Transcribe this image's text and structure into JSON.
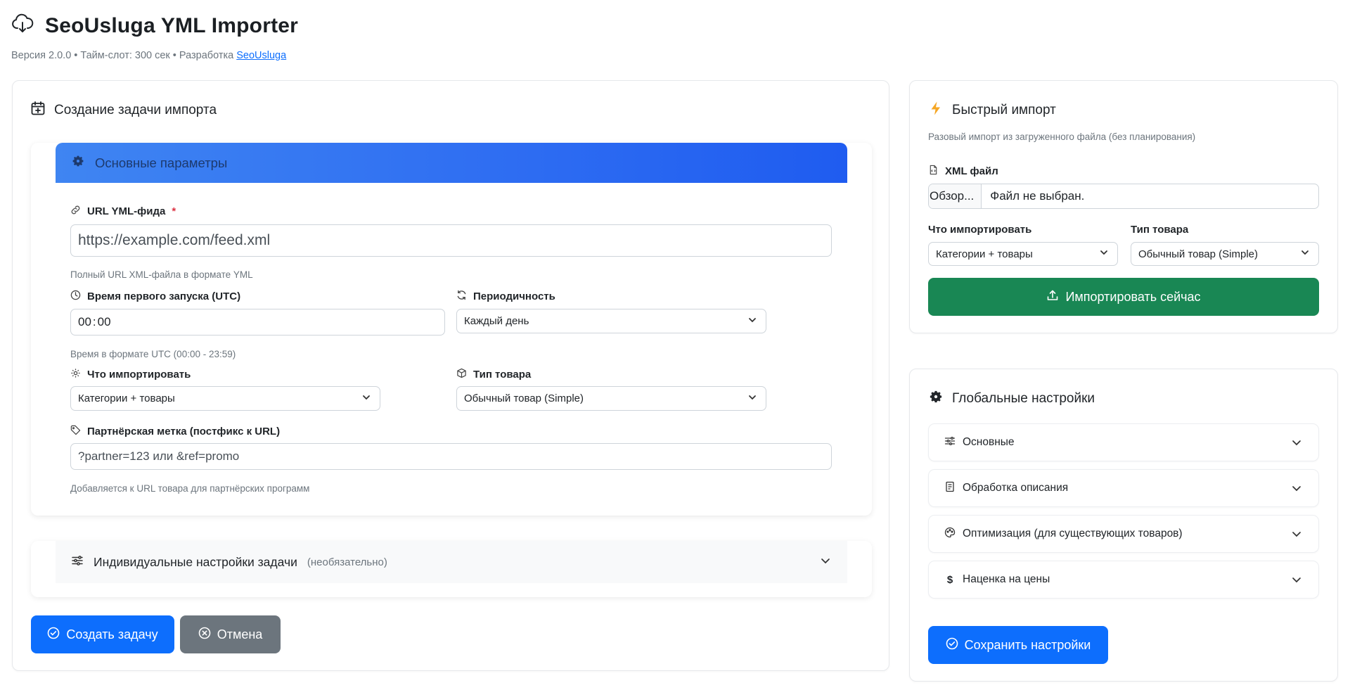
{
  "header": {
    "title": "SeoUsluga YML Importer",
    "subtitle": "Версия 2.0.0 • Тайм-слот: 300 сек • Разработка",
    "dev_link": "SeoUsluga"
  },
  "create_task": {
    "title": "Создание задачи импорта",
    "params_header": "Основные параметры",
    "url": {
      "label": "URL YML-фида",
      "required_mark": "*",
      "placeholder": "https://example.com/feed.xml",
      "hint": "Полный URL XML-файла в формате YML"
    },
    "first_run": {
      "label": "Время первого запуска (UTC)",
      "hours": "00",
      "separator": ":",
      "minutes": "00",
      "hint": "Время в формате UTC (00:00 - 23:59)"
    },
    "periodicity": {
      "label": "Периодичность",
      "value": "Каждый день"
    },
    "what_import": {
      "label": "Что импортировать",
      "value": "Категории + товары"
    },
    "product_type": {
      "label": "Тип товара",
      "value": "Обычный товар (Simple)"
    },
    "partner": {
      "label": "Партнёрская метка (постфикс к URL)",
      "placeholder": "?partner=123 или &ref=promo",
      "hint": "Добавляется к URL товара для партнёрских программ"
    },
    "individual": {
      "label": "Индивидуальные настройки задачи",
      "note": "(необязательно)"
    },
    "create_button": "Создать задачу",
    "cancel_button": "Отмена"
  },
  "quick_import": {
    "title": "Быстрый импорт",
    "subtitle": "Разовый импорт из загруженного файла (без планирования)",
    "file": {
      "label": "XML файл",
      "browse": "Обзор...",
      "status": "Файл не выбран."
    },
    "what_import": {
      "label": "Что импортировать",
      "value": "Категории + товары"
    },
    "product_type": {
      "label": "Тип товара",
      "value": "Обычный товар (Simple)"
    },
    "import_button": "Импортировать сейчас"
  },
  "global_settings": {
    "title": "Глобальные настройки",
    "items": [
      {
        "label": "Основные",
        "icon": "sliders-icon"
      },
      {
        "label": "Обработка описания",
        "icon": "document-icon"
      },
      {
        "label": "Оптимизация (для существующих товаров)",
        "icon": "palette-icon"
      },
      {
        "label": "Наценка на цены",
        "icon": "dollar-icon"
      }
    ],
    "save_button": "Сохранить настройки"
  },
  "colors": {
    "primary": "#0d6efd",
    "success": "#198754",
    "secondary": "#6c757d",
    "header_gradient": "#2f6ef2",
    "lightning": "#f5a623"
  }
}
